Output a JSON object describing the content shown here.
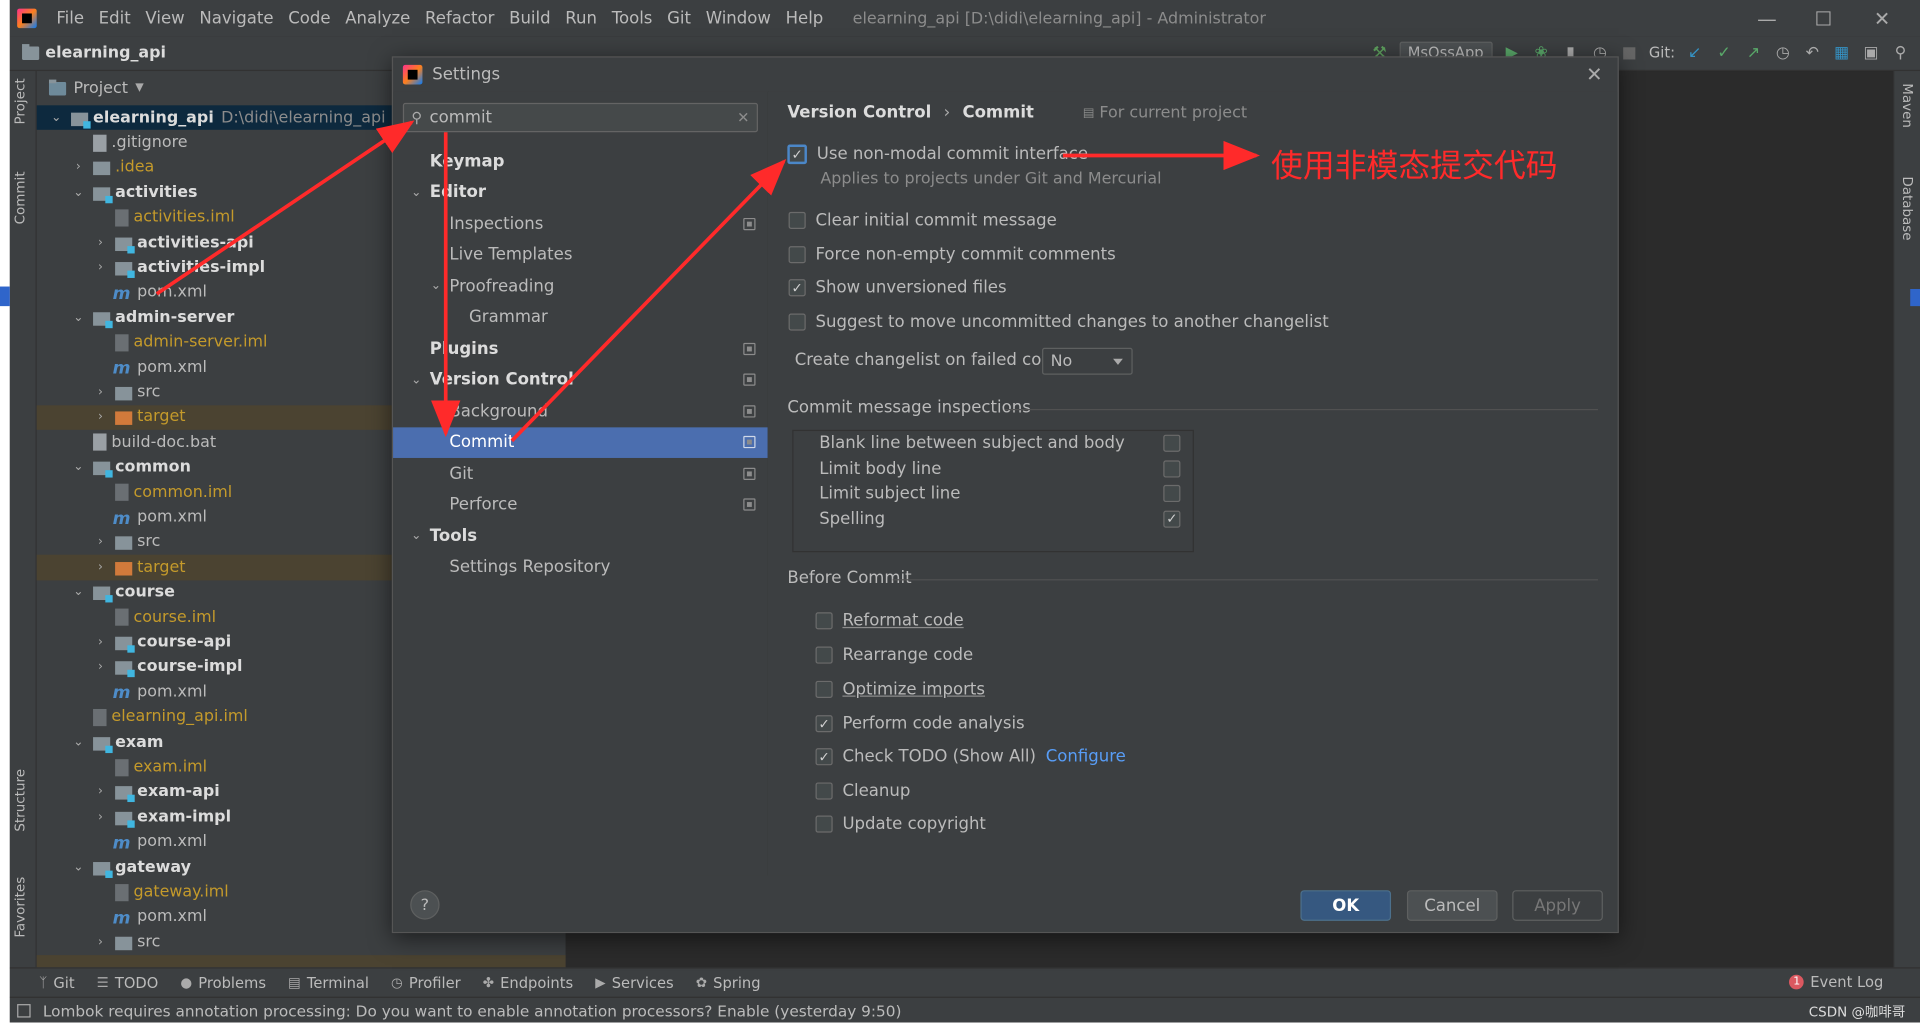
{
  "app": {
    "menu": [
      "File",
      "Edit",
      "View",
      "Navigate",
      "Code",
      "Analyze",
      "Refactor",
      "Build",
      "Run",
      "Tools",
      "Git",
      "Window",
      "Help"
    ],
    "window_title": "elearning_api [D:\\didi\\elearning_api] - Administrator",
    "breadcrumb": "elearning_api",
    "run_config": "MsOssApp",
    "git_label": "Git:"
  },
  "left_strip": {
    "project": "Project",
    "commit": "Commit",
    "structure": "Structure",
    "favorites": "Favorites"
  },
  "right_strip": {
    "maven": "Maven",
    "database": "Database"
  },
  "project_panel": {
    "header": "Project",
    "rows": [
      {
        "name": "elearning_api",
        "path": "D:\\didi\\elearning_api"
      },
      {
        "name": ".gitignore"
      },
      {
        "name": ".idea"
      },
      {
        "name": "activities"
      },
      {
        "name": "activities.iml"
      },
      {
        "name": "activities-api"
      },
      {
        "name": "activities-impl"
      },
      {
        "name": "pom.xml"
      },
      {
        "name": "admin-server"
      },
      {
        "name": "admin-server.iml"
      },
      {
        "name": "pom.xml"
      },
      {
        "name": "src"
      },
      {
        "name": "target"
      },
      {
        "name": "build-doc.bat"
      },
      {
        "name": "common"
      },
      {
        "name": "common.iml"
      },
      {
        "name": "pom.xml"
      },
      {
        "name": "src"
      },
      {
        "name": "target"
      },
      {
        "name": "course"
      },
      {
        "name": "course.iml"
      },
      {
        "name": "course-api"
      },
      {
        "name": "course-impl"
      },
      {
        "name": "pom.xml"
      },
      {
        "name": "elearning_api.iml"
      },
      {
        "name": "exam"
      },
      {
        "name": "exam.iml"
      },
      {
        "name": "exam-api"
      },
      {
        "name": "exam-impl"
      },
      {
        "name": "pom.xml"
      },
      {
        "name": "gateway"
      },
      {
        "name": "gateway.iml"
      },
      {
        "name": "pom.xml"
      },
      {
        "name": "src"
      }
    ]
  },
  "bottom_tools": [
    "Git",
    "TODO",
    "Problems",
    "Terminal",
    "Profiler",
    "Endpoints",
    "Services",
    "Spring"
  ],
  "event_log": {
    "count": "1",
    "label": "Event Log"
  },
  "status": {
    "message": "Lombok requires annotation processing: Do you want to enable annotation processors? Enable (yesterday 9:50)",
    "watermark": "CSDN @咖啡哥"
  },
  "settings": {
    "title": "Settings",
    "search_value": "commit",
    "nav": [
      {
        "label": "Keymap"
      },
      {
        "label": "Editor"
      },
      {
        "label": "Inspections"
      },
      {
        "label": "Live Templates"
      },
      {
        "label": "Proofreading"
      },
      {
        "label": "Grammar"
      },
      {
        "label": "Plugins"
      },
      {
        "label": "Version Control"
      },
      {
        "label": "Background"
      },
      {
        "label": "Commit"
      },
      {
        "label": "Git"
      },
      {
        "label": "Perforce"
      },
      {
        "label": "Tools"
      },
      {
        "label": "Settings Repository"
      }
    ],
    "breadcrumb": [
      "Version Control",
      "Commit"
    ],
    "scope_note": "For current project",
    "options": [
      {
        "label": "Use non-modal commit interface",
        "checked": true
      },
      {
        "label": "Clear initial commit message",
        "checked": false
      },
      {
        "label": "Force non-empty commit comments",
        "checked": false
      },
      {
        "label": "Show unversioned files",
        "checked": true
      },
      {
        "label": "Suggest to move uncommitted changes to another changelist",
        "checked": false
      }
    ],
    "non_modal_hint": "Applies to projects under Git and Mercurial",
    "changelist_label": "Create changelist on failed commit:",
    "changelist_value": "No",
    "inspections_title": "Commit message inspections",
    "inspections": [
      {
        "label": "Blank line between subject and body",
        "checked": false
      },
      {
        "label": "Limit body line",
        "checked": false
      },
      {
        "label": "Limit subject line",
        "checked": false
      },
      {
        "label": "Spelling",
        "checked": true
      }
    ],
    "before_commit_title": "Before Commit",
    "before_commit": [
      {
        "label": "Reformat code",
        "checked": false
      },
      {
        "label": "Rearrange code",
        "checked": false
      },
      {
        "label": "Optimize imports",
        "checked": false
      },
      {
        "label": "Perform code analysis",
        "checked": true
      },
      {
        "label": "Check TODO (Show All)",
        "checked": true,
        "link": "Configure"
      },
      {
        "label": "Cleanup",
        "checked": false
      },
      {
        "label": "Update copyright",
        "checked": false
      }
    ],
    "buttons": {
      "help": "?",
      "ok": "OK",
      "cancel": "Cancel",
      "apply": "Apply"
    }
  },
  "annotation": "使用非模态提交代码",
  "colors": {
    "selection": "#4b6eaf",
    "accent_red": "#ff2a2a",
    "link": "#589df6"
  }
}
